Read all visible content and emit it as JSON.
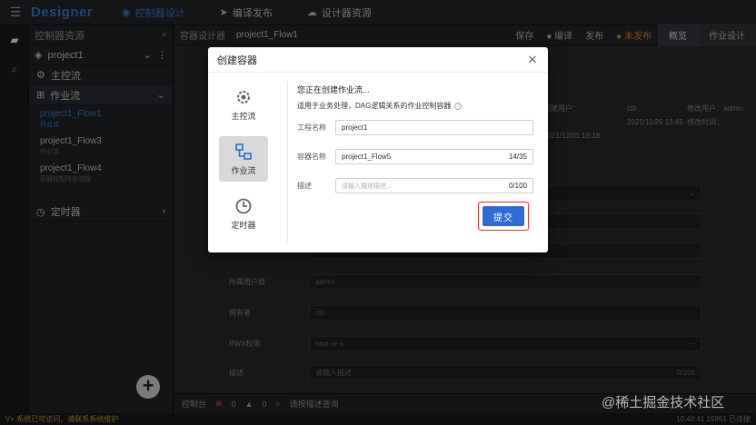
{
  "app": {
    "brand": "Designer"
  },
  "nav": [
    {
      "label": "控制器设计",
      "icon": "◉"
    },
    {
      "label": "编译发布",
      "icon": "➤"
    },
    {
      "label": "设计器资源",
      "icon": "☁"
    }
  ],
  "panel": {
    "title": "控制器资源",
    "project": "project1",
    "groups": {
      "main": "主控流",
      "job": "作业流",
      "timer": "定时器"
    },
    "flows": [
      {
        "name": "project1_Flow1",
        "sub": "作业流"
      },
      {
        "name": "project1_Flow3",
        "sub": "作业流"
      },
      {
        "name": "project1_Flow4",
        "sub": "容器控制作业流程"
      }
    ]
  },
  "main": {
    "breadcrumb": [
      "容器设计器",
      "project1_Flow1"
    ],
    "actions": {
      "save": "保存",
      "compile": "● 编译",
      "publish": "发布",
      "unpublished": "● 未发布",
      "overview": "概览",
      "job_design": "作业设计"
    },
    "meta": {
      "creator_label": "创建用户：",
      "creator": "cth",
      "modifier_label": "修改用户：",
      "modifier": "admin",
      "created": "2021/11/26 13:45",
      "modified_label": "修改时间：",
      "modified": "2021/12/01 16:18"
    },
    "fields": {
      "owner_user_label": "所属用户组",
      "owner_user_value": "admin",
      "owner_label": "拥有者",
      "owner_value": "cth",
      "rwx_label": "RWX权限",
      "rwx_value": "rwxr-xr-x",
      "desc_label": "描述",
      "desc_placeholder": "请输入描述",
      "desc_count": "0/100"
    }
  },
  "console": {
    "label": "控制台",
    "errors": "0",
    "warnings": "0",
    "filter": "请按描述查询"
  },
  "statusbar": {
    "left": "V+ 系统已可访问，请联系系统维护",
    "right": "10:40:41 15861 已连接"
  },
  "dialog": {
    "title": "创建容器",
    "types": [
      {
        "label": "主控流",
        "icon": "gear-icon"
      },
      {
        "label": "作业流",
        "icon": "flow-icon"
      },
      {
        "label": "定时器",
        "icon": "clock-icon"
      }
    ],
    "heading": "您正在创建作业流...",
    "subheading": "适用于业务处理，DAG逻辑关系的作业控制容器",
    "project_label": "工程名称",
    "project_value": "project1",
    "container_label": "容器名称",
    "container_value": "project1_Flow5",
    "container_count": "14/35",
    "desc_label": "描述",
    "desc_placeholder": "请输入描述描述...",
    "desc_count": "0/100",
    "submit_label": "提交"
  },
  "watermark": "@稀土掘金技术社区",
  "colors": {
    "accent": "#2f6bd6",
    "highlight": "#e03030",
    "warning": "#e0882a"
  }
}
